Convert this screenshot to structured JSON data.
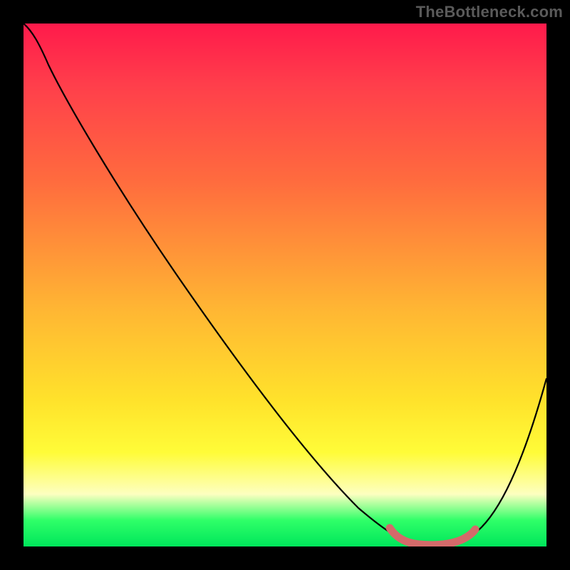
{
  "watermark": "TheBottleneck.com",
  "chart_data": {
    "type": "line",
    "title": "",
    "xlabel": "",
    "ylabel": "",
    "xlim": [
      0,
      100
    ],
    "ylim": [
      0,
      100
    ],
    "grid": false,
    "series": [
      {
        "name": "bottleneck-curve",
        "x": [
          0,
          4,
          10,
          20,
          30,
          40,
          50,
          57,
          62,
          67,
          72,
          76,
          80,
          85,
          90,
          95,
          100
        ],
        "y": [
          100,
          97,
          92,
          79,
          66,
          53,
          40,
          30,
          22,
          13,
          5,
          1,
          0,
          1,
          7,
          18,
          32
        ]
      },
      {
        "name": "optimal-range",
        "x": [
          70,
          73,
          77,
          81,
          84,
          86
        ],
        "y": [
          3.5,
          1.5,
          0.4,
          0.3,
          1.1,
          2.6
        ]
      }
    ],
    "colors": {
      "black_curve": "#000000",
      "optimal_marker": "#d46a6a",
      "gradient_top": "#ff1a4b",
      "gradient_mid": "#ffe22b",
      "gradient_bottom": "#00e65b"
    }
  }
}
